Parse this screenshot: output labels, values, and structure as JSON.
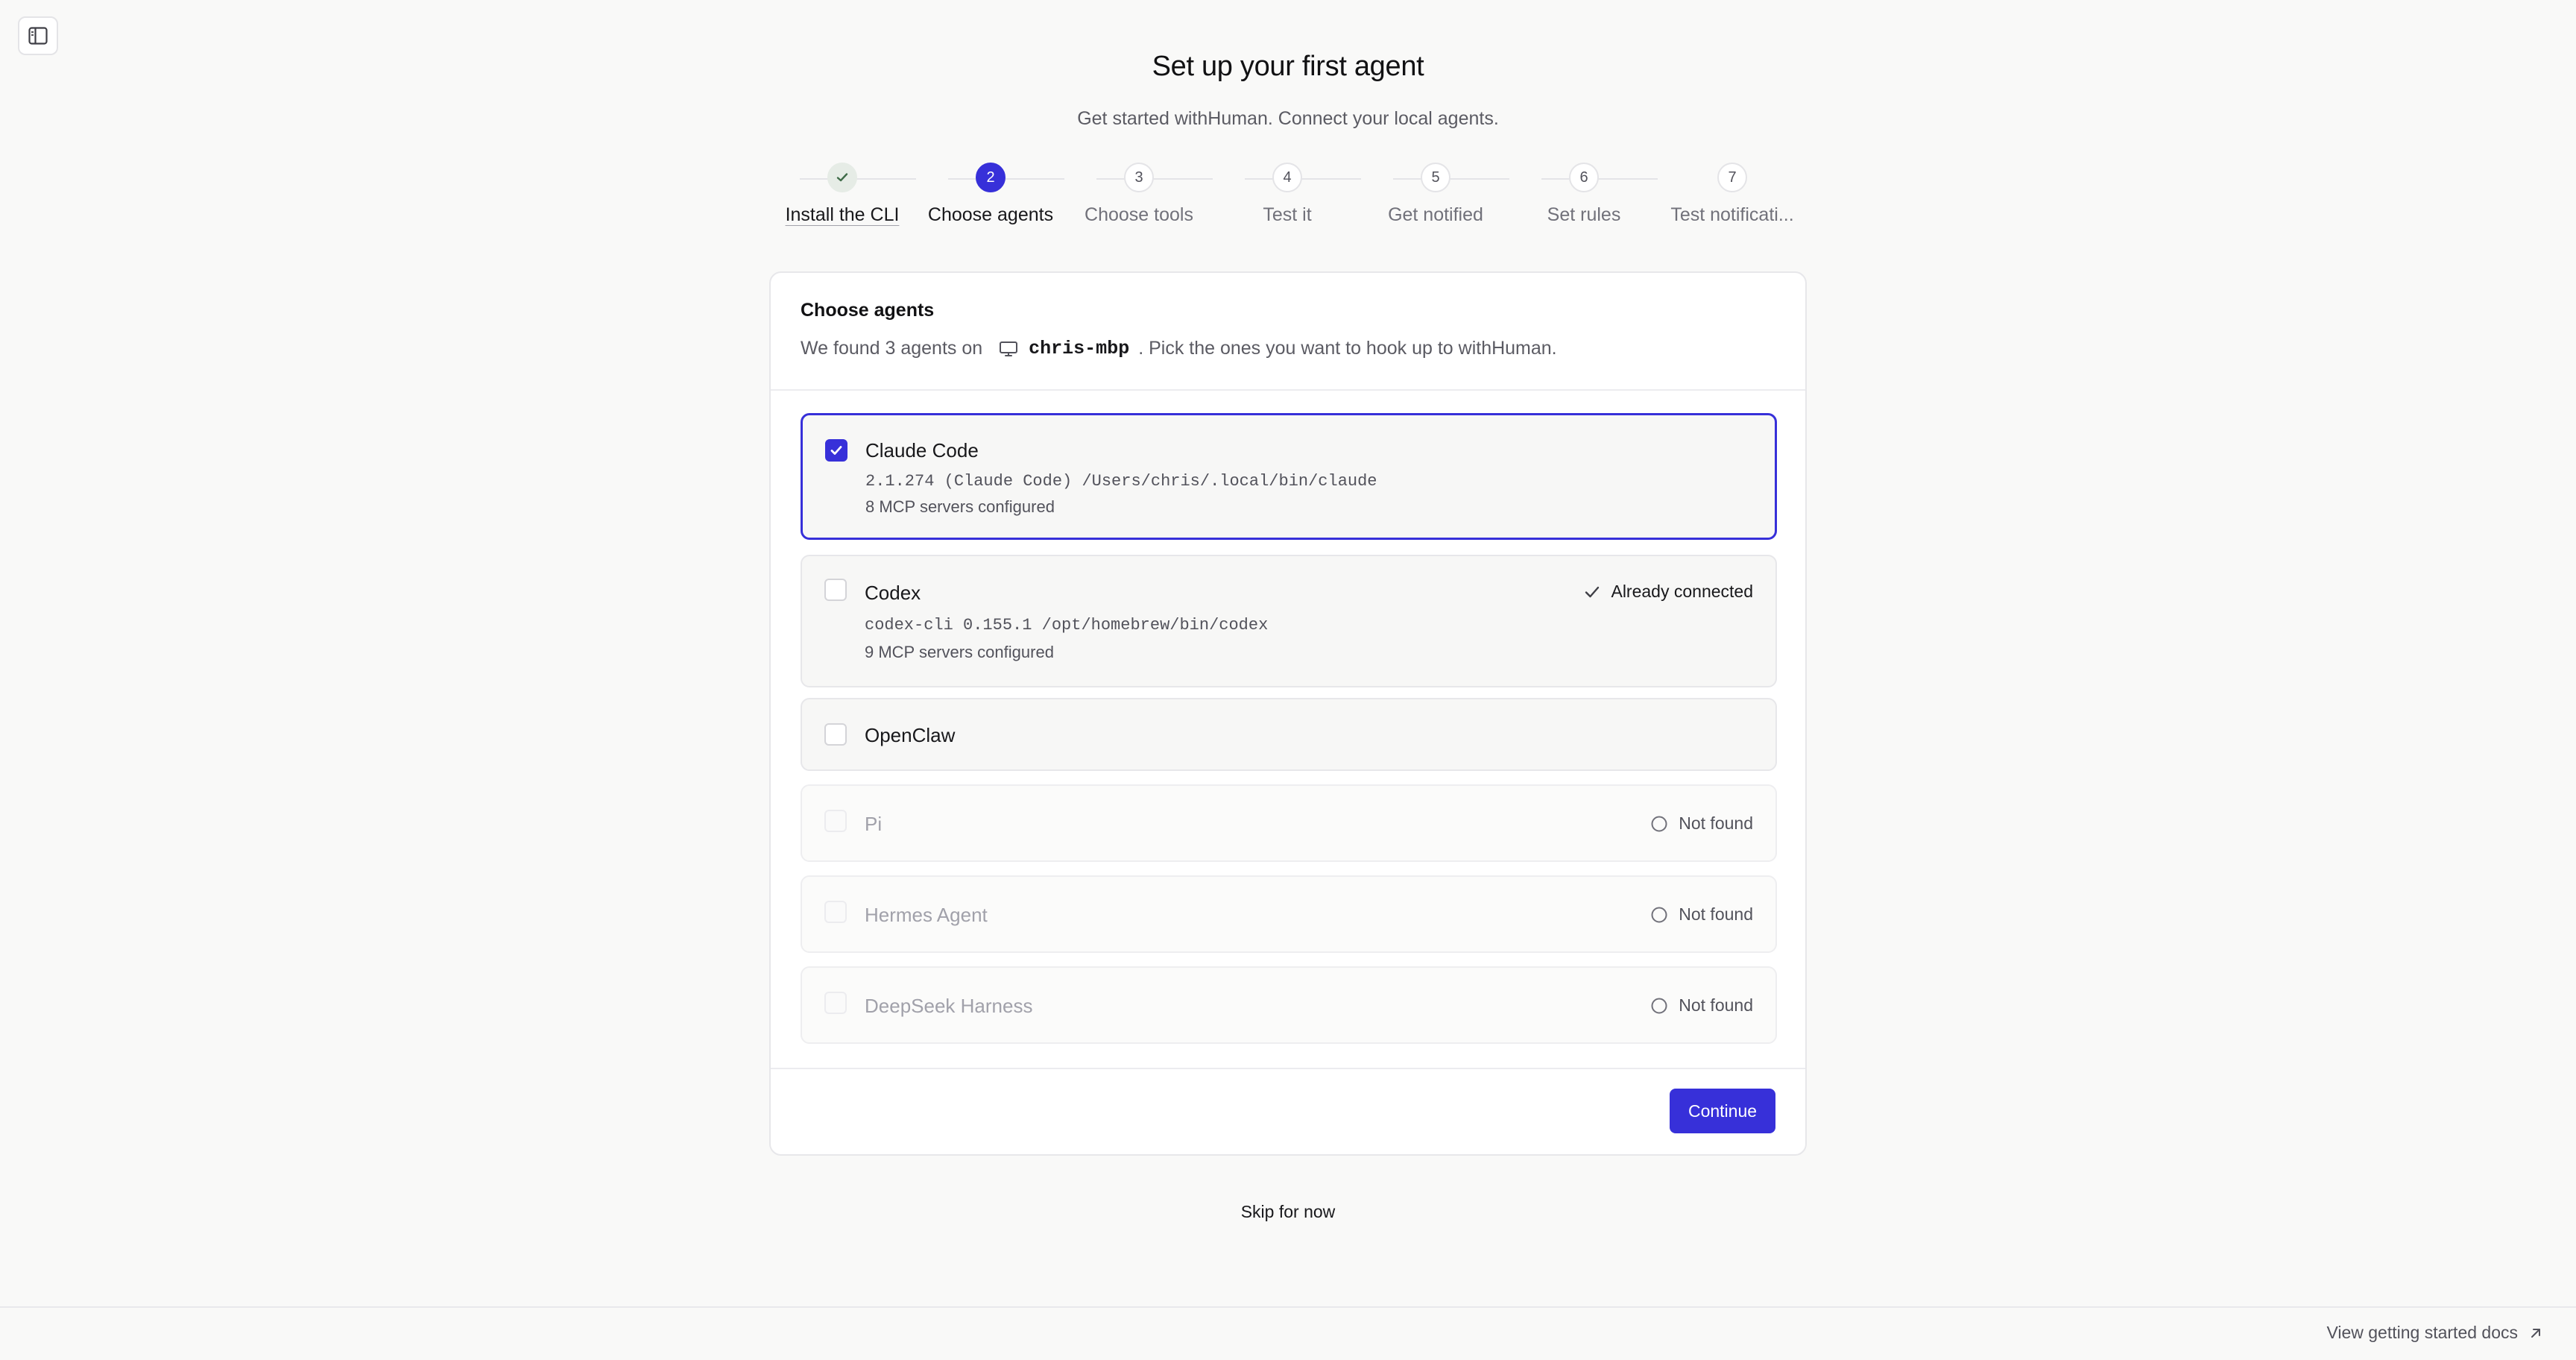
{
  "header": {
    "title": "Set up your first agent",
    "subtitle": "Get started withHuman. Connect your local agents."
  },
  "stepper": {
    "steps": [
      {
        "number": "1",
        "label": "Install the CLI",
        "state": "done"
      },
      {
        "number": "2",
        "label": "Choose agents",
        "state": "active"
      },
      {
        "number": "3",
        "label": "Choose tools",
        "state": "pending"
      },
      {
        "number": "4",
        "label": "Test it",
        "state": "pending"
      },
      {
        "number": "5",
        "label": "Get notified",
        "state": "pending"
      },
      {
        "number": "6",
        "label": "Set rules",
        "state": "pending"
      },
      {
        "number": "7",
        "label": "Test notificati...",
        "state": "pending"
      }
    ]
  },
  "card": {
    "title": "Choose agents",
    "desc_prefix": "We found 3 agents on",
    "host": "chris-mbp",
    "desc_suffix": ". Pick the ones you want to hook up to withHuman."
  },
  "agents": [
    {
      "name": "Claude Code",
      "version": "2.1.274 (Claude Code) /Users/chris/.local/bin/claude",
      "mcp": "8 MCP servers configured",
      "checked": true,
      "status": ""
    },
    {
      "name": "Codex",
      "version": "codex-cli 0.155.1 /opt/homebrew/bin/codex",
      "mcp": "9 MCP servers configured",
      "checked": false,
      "status": "Already connected"
    },
    {
      "name": "OpenClaw",
      "checked": false,
      "status": ""
    },
    {
      "name": "Pi",
      "checked": false,
      "status": "Not found"
    },
    {
      "name": "Hermes Agent",
      "checked": false,
      "status": "Not found"
    },
    {
      "name": "DeepSeek Harness",
      "checked": false,
      "status": "Not found"
    }
  ],
  "actions": {
    "continue_label": "Continue",
    "skip_label": "Skip for now"
  },
  "footer": {
    "docs_label": "View getting started docs"
  },
  "colors": {
    "accent": "#3730d9",
    "background": "#f9f9f8",
    "done_step": "#e6ece6"
  },
  "icons": {
    "sidebar_toggle": "sidebar-toggle-icon",
    "step_done": "check-icon",
    "host": "monitor-icon",
    "connected": "check-icon",
    "not_found": "circle-icon",
    "docs": "arrow-up-right-icon"
  }
}
